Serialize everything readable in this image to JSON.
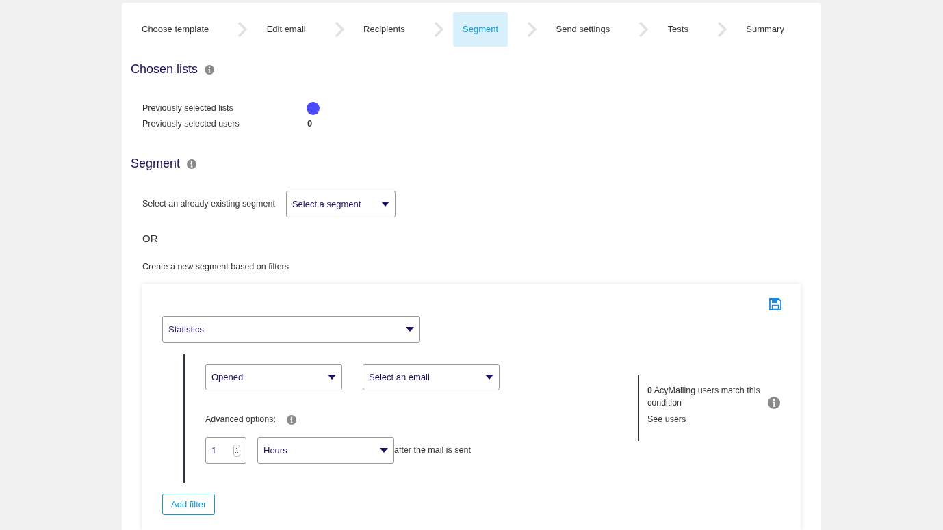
{
  "steps": [
    {
      "label": "Choose template",
      "selected": false
    },
    {
      "label": "Edit email",
      "selected": false
    },
    {
      "label": "Recipients",
      "selected": false
    },
    {
      "label": "Segment",
      "selected": true
    },
    {
      "label": "Send settings",
      "selected": false
    },
    {
      "label": "Tests",
      "selected": false
    },
    {
      "label": "Summary",
      "selected": false
    }
  ],
  "chosen_lists": {
    "title": "Chosen lists",
    "rows": [
      {
        "kind": "dot",
        "label": "Previously selected lists",
        "color": "#4a4aff"
      },
      {
        "kind": "text",
        "label": "Previously selected users",
        "value": "0"
      }
    ]
  },
  "segment": {
    "title": "Segment",
    "existing_label": "Select an already existing segment",
    "existing_select": "Select a segment",
    "or": "OR",
    "create_label": "Create a new segment based on filters",
    "filter": {
      "type_select": "Statistics",
      "action_select": "Opened",
      "email_select": "Select an email",
      "advanced_label": "Advanced options:",
      "number": "1",
      "unit_select": "Hours",
      "after_text": "after the mail is sent",
      "match_count": "0",
      "match_text": "AcyMailing users match this condition",
      "see_users": "See users"
    },
    "add_filter": "Add filter"
  }
}
